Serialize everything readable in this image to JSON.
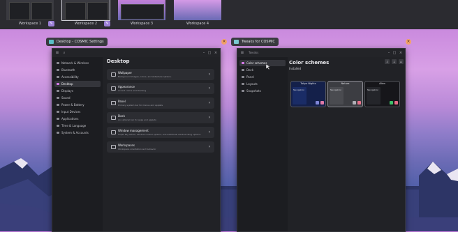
{
  "workspaces": [
    {
      "label": "Workspace 1",
      "pinned": true,
      "active": false
    },
    {
      "label": "Workspace 2",
      "pinned": true,
      "active": true
    },
    {
      "label": "Workspace 3",
      "pinned": false,
      "active": false
    },
    {
      "label": "Workspace 4",
      "pinned": false,
      "active": false
    }
  ],
  "settings_window": {
    "title": "Desktop - COSMIC Settings",
    "sidebar": [
      "Network & Wireless",
      "Bluetooth",
      "Accessibility",
      "Desktop",
      "Displays",
      "Sound",
      "Power & Battery",
      "Input Devices",
      "Applications",
      "Time & Language",
      "System & Accounts"
    ],
    "selected_item": "Desktop",
    "page_title": "Desktop",
    "cards": [
      {
        "title": "Wallpaper",
        "subtitle": "Background images, colors, and slideshow options."
      },
      {
        "title": "Appearance",
        "subtitle": "Accent colors and theming"
      },
      {
        "title": "Panel",
        "subtitle": "Primary system bar for menus and applets"
      },
      {
        "title": "Dock",
        "subtitle": "An optional bar for apps and applets"
      },
      {
        "title": "Window management",
        "subtitle": "Super key action, window control options, and additional window tiling options."
      },
      {
        "title": "Workspaces",
        "subtitle": "Workspace orientation and behavior"
      }
    ]
  },
  "tweaks_window": {
    "title": "Tweaks for COSMIC",
    "search_placeholder": "Tweaks",
    "sidebar": [
      "Color schemes",
      "Dock",
      "Panel",
      "Layouts",
      "Snapshots"
    ],
    "selected_item": "Color schemes",
    "page_title": "Color schemes",
    "section": "Installed",
    "schemes": [
      {
        "name": "Tokyo Nights",
        "nav_label": "Navigation",
        "bg": "#14204a",
        "nav": "#1a2c66",
        "b1": "#7f86d8",
        "b2": "#e07aa8"
      },
      {
        "name": "Nature",
        "nav_label": "Navigation",
        "bg": "#3c3d42",
        "nav": "#4a4b50",
        "b1": "#b0b0b6",
        "b2": "#e8708a"
      },
      {
        "name": "Alien",
        "nav_label": "Navigation",
        "bg": "#16161a",
        "nav": "#24252a",
        "b1": "#3fbf6a",
        "b2": "#e86a86"
      }
    ]
  }
}
